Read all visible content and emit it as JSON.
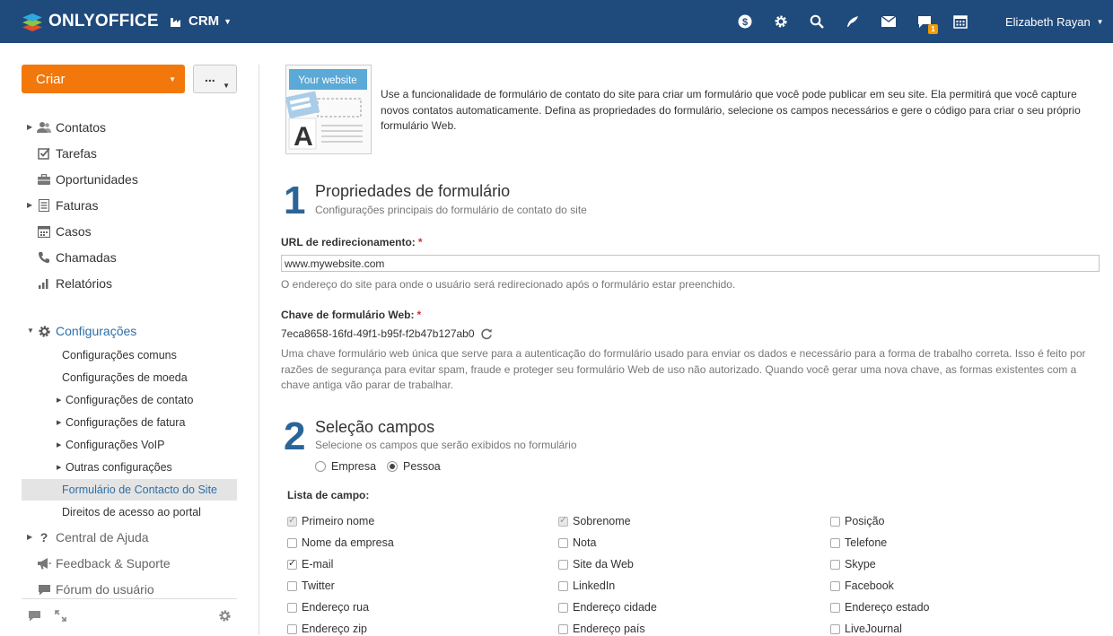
{
  "header": {
    "brand": "ONLYOFFICE",
    "module": "CRM",
    "user": "Elizabeth Rayan",
    "notification_count": "1",
    "icons": [
      "dollar-icon",
      "gear-icon",
      "search-icon",
      "feed-icon",
      "mail-icon",
      "chat-icon",
      "calendar-icon"
    ]
  },
  "sidebar": {
    "create_label": "Criar",
    "more_label": "...",
    "nav": [
      {
        "label": "Contatos",
        "icon": "people-icon",
        "arrow": true
      },
      {
        "label": "Tarefas",
        "icon": "tasks-icon",
        "arrow": false
      },
      {
        "label": "Oportunidades",
        "icon": "briefcase-icon",
        "arrow": false
      },
      {
        "label": "Faturas",
        "icon": "invoice-icon",
        "arrow": true
      },
      {
        "label": "Casos",
        "icon": "cases-icon",
        "arrow": false
      },
      {
        "label": "Chamadas",
        "icon": "phone-icon",
        "arrow": false
      },
      {
        "label": "Relatórios",
        "icon": "reports-icon",
        "arrow": false
      }
    ],
    "settings_label": "Configurações",
    "settings_items": [
      {
        "label": "Configurações comuns",
        "arrow": false
      },
      {
        "label": "Configurações de moeda",
        "arrow": false
      },
      {
        "label": "Configurações de contato",
        "arrow": true
      },
      {
        "label": "Configurações de fatura",
        "arrow": true
      },
      {
        "label": "Configurações VoIP",
        "arrow": true
      },
      {
        "label": "Outras configurações",
        "arrow": true
      },
      {
        "label": "Formulário de Contacto do Site",
        "arrow": false,
        "selected": true
      },
      {
        "label": "Direitos de acesso ao portal",
        "arrow": false
      }
    ],
    "help_label": "Central de Ajuda",
    "feedback_label": "Feedback & Suporte",
    "forum_label": "Fórum do usuário"
  },
  "main": {
    "intro_image_caption": "Your website",
    "intro": "Use a funcionalidade de formulário de contato do site para criar um formulário que você pode publicar em seu site. Ela permitirá que você capture novos contatos automaticamente. Defina as propriedades do formulário, selecione os campos necessários e gere o código para criar o seu próprio formulário Web.",
    "step1": {
      "number": "1",
      "title": "Propriedades de formulário",
      "subtitle": "Configurações principais do formulário de contato do site"
    },
    "redirect_label": "URL de redirecionamento:",
    "redirect_value": "www.mywebsite.com",
    "redirect_help": "O endereço do site para onde o usuário será redirecionado após o formulário estar preenchido.",
    "key_label": "Chave de formulário Web:",
    "key_value": "7eca8658-16fd-49f1-b95f-f2b47b127ab0",
    "key_help": "Uma chave formulário web única que serve para a autenticação do formulário usado para enviar os dados e necessário para a forma de trabalho correta. Isso é feito por razões de segurança para evitar spam, fraude e proteger seu formulário Web de uso não autorizado. Quando você gerar uma nova chave, as formas existentes com a chave antiga vão parar de trabalhar.",
    "required_mark": "*",
    "step2": {
      "number": "2",
      "title": "Seleção campos",
      "subtitle": "Selecione os campos que serão exibidos no formulário"
    },
    "radio_company": "Empresa",
    "radio_person": "Pessoa",
    "selected_type": "Pessoa",
    "field_list_label": "Lista de campo:",
    "fields": [
      [
        {
          "label": "Primeiro nome",
          "checked": true,
          "disabled": true
        },
        {
          "label": "Nome da empresa",
          "checked": false,
          "disabled": false
        },
        {
          "label": "E-mail",
          "checked": true,
          "disabled": false
        },
        {
          "label": "Twitter",
          "checked": false,
          "disabled": false
        },
        {
          "label": "Endereço rua",
          "checked": false,
          "disabled": false
        },
        {
          "label": "Endereço zip",
          "checked": false,
          "disabled": false
        }
      ],
      [
        {
          "label": "Sobrenome",
          "checked": true,
          "disabled": true
        },
        {
          "label": "Nota",
          "checked": false,
          "disabled": false
        },
        {
          "label": "Site da Web",
          "checked": false,
          "disabled": false
        },
        {
          "label": "LinkedIn",
          "checked": false,
          "disabled": false
        },
        {
          "label": "Endereço cidade",
          "checked": false,
          "disabled": false
        },
        {
          "label": "Endereço país",
          "checked": false,
          "disabled": false
        }
      ],
      [
        {
          "label": "Posição",
          "checked": false,
          "disabled": false
        },
        {
          "label": "Telefone",
          "checked": false,
          "disabled": false
        },
        {
          "label": "Skype",
          "checked": false,
          "disabled": false
        },
        {
          "label": "Facebook",
          "checked": false,
          "disabled": false
        },
        {
          "label": "Endereço estado",
          "checked": false,
          "disabled": false
        },
        {
          "label": "LiveJournal",
          "checked": false,
          "disabled": false
        }
      ]
    ]
  },
  "colors": {
    "header_bg": "#1f4a7c",
    "create_button": "#f2780c",
    "link_active": "#2d6fa8",
    "step_number": "#2a6598",
    "badge": "#f29b00"
  }
}
